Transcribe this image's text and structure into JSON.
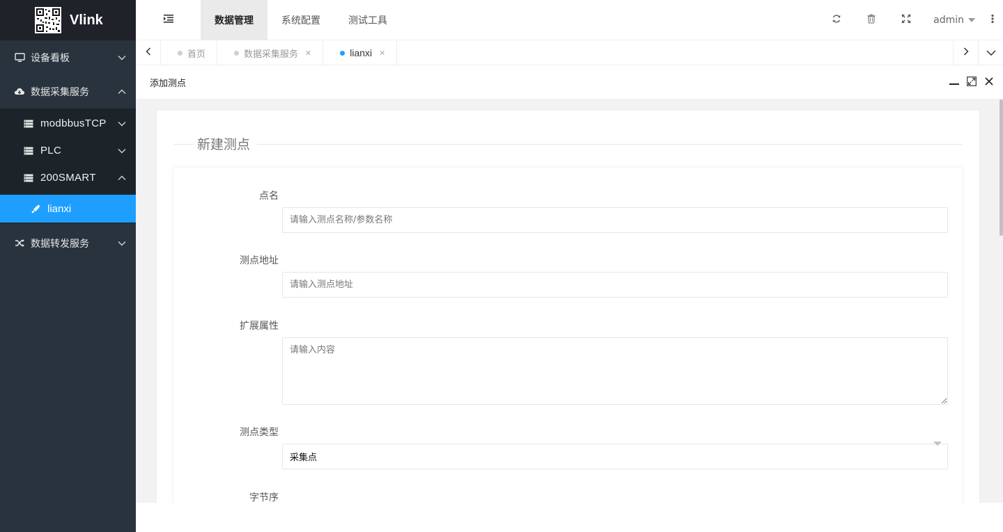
{
  "app": {
    "title": "Vlink"
  },
  "sidebar": {
    "items": [
      {
        "label": "设备看板",
        "icon": "monitor-icon",
        "expanded": false
      },
      {
        "label": "数据采集服务",
        "icon": "cloud-download-icon",
        "expanded": true
      },
      {
        "label": "数据转发服务",
        "icon": "shuffle-icon",
        "expanded": false
      }
    ],
    "sub_items": [
      {
        "label": "modbbusTCP",
        "icon": "server-icon",
        "expanded": false
      },
      {
        "label": "PLC",
        "icon": "server-icon",
        "expanded": false
      },
      {
        "label": "200SMART",
        "icon": "server-icon",
        "expanded": true
      }
    ],
    "active_leaf": {
      "label": "lianxi",
      "icon": "plug-icon"
    }
  },
  "header": {
    "tabs": [
      {
        "label": "数据管理",
        "active": true
      },
      {
        "label": "系统配置",
        "active": false
      },
      {
        "label": "测试工具",
        "active": false
      }
    ],
    "user": "admin"
  },
  "page_tabs": [
    {
      "label": "首页",
      "active": false,
      "closable": false
    },
    {
      "label": "数据采集服务",
      "active": false,
      "closable": true
    },
    {
      "label": "lianxi",
      "active": true,
      "closable": true
    }
  ],
  "dialog": {
    "title": "添加测点",
    "legend": "新建测点",
    "fields": {
      "name": {
        "label": "点名",
        "placeholder": "请输入测点名称/参数名称",
        "value": ""
      },
      "address": {
        "label": "测点地址",
        "placeholder": "请输入测点地址",
        "value": ""
      },
      "ext": {
        "label": "扩展属性",
        "placeholder": "请输入内容",
        "value": ""
      },
      "type": {
        "label": "测点类型",
        "value": "采集点"
      },
      "byte_order": {
        "label": "字节序"
      }
    }
  },
  "colors": {
    "sidebar_bg": "#28333e",
    "logo_bg": "#20222a",
    "accent": "#1e9fff",
    "submenu_bg": "#1d2429"
  }
}
